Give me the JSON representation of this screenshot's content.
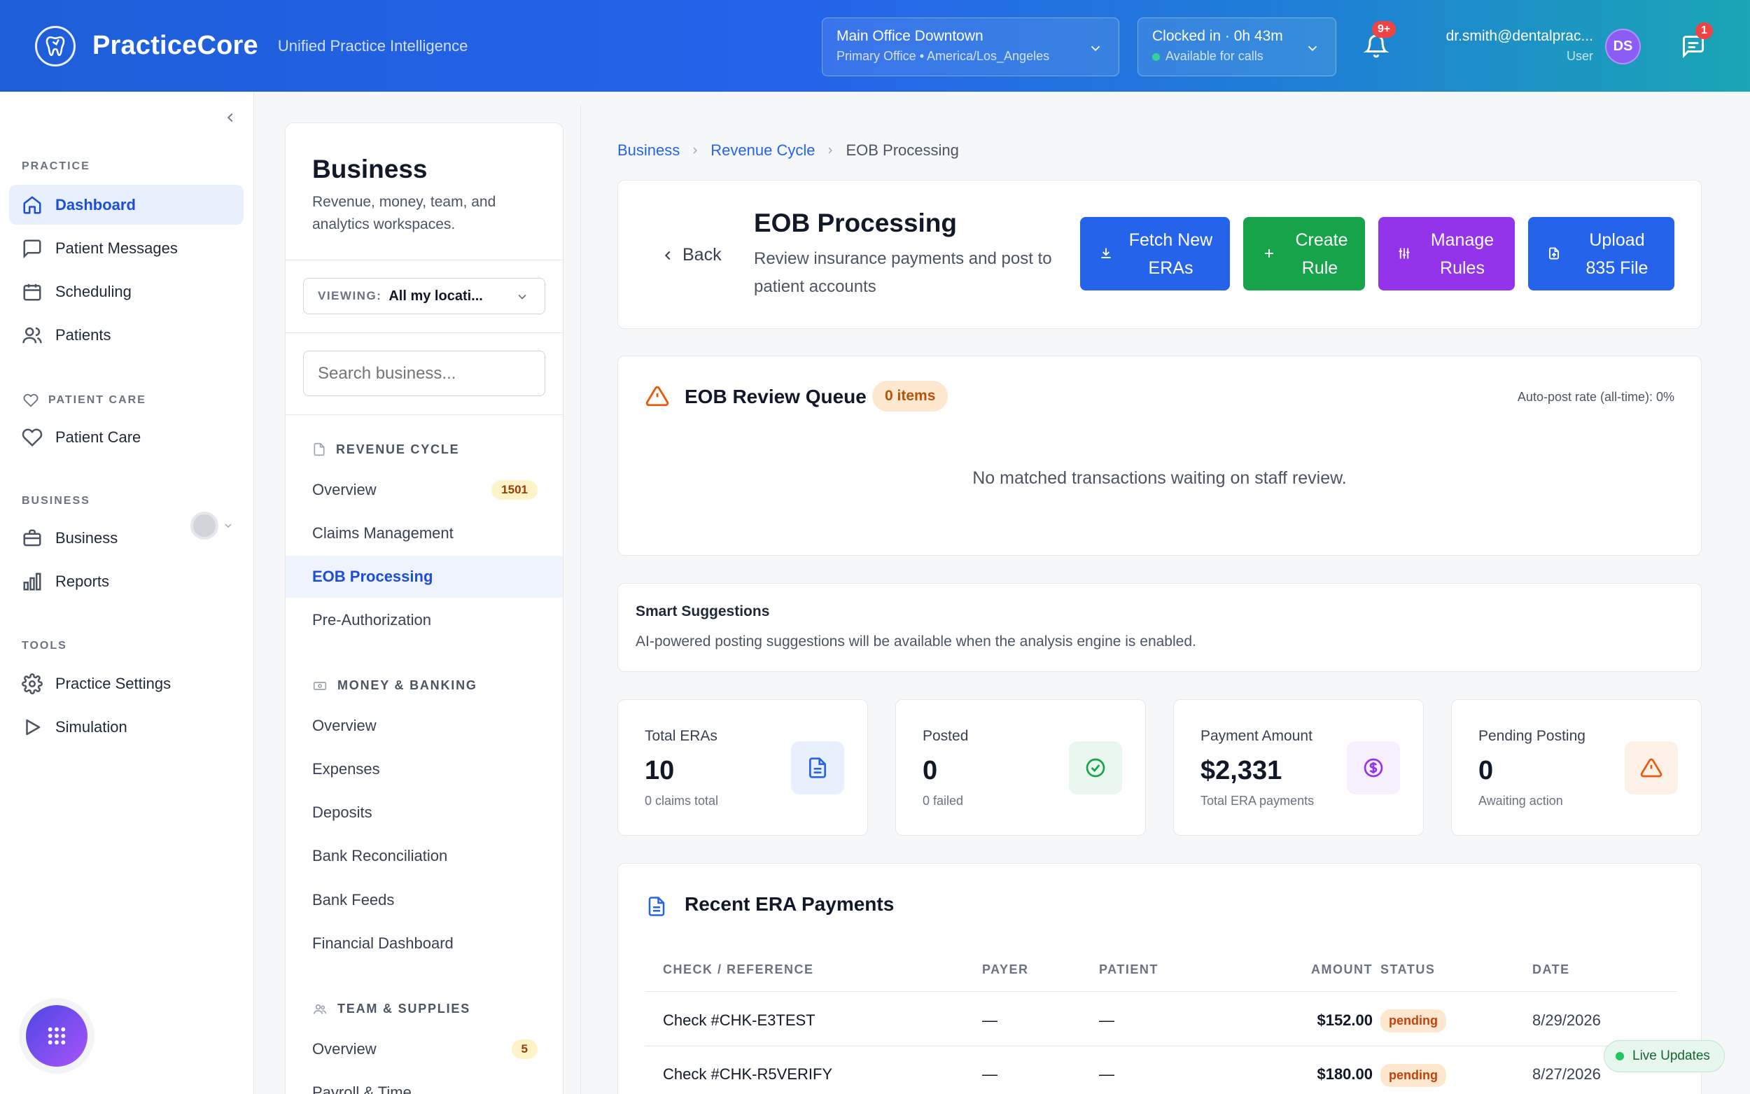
{
  "topbar": {
    "brand": "PracticeCore",
    "tagline": "Unified Practice Intelligence",
    "location": {
      "title": "Main Office Downtown",
      "subtitle": "Primary Office • America/Los_Angeles"
    },
    "clock": {
      "title": "Clocked in · 0h 43m",
      "subtitle": "Available for calls"
    },
    "notifications_badge": "9+",
    "user": {
      "email": "dr.smith@dentalprac...",
      "role": "User",
      "initials": "DS"
    },
    "messages_badge": "1",
    "colors": {
      "start": "#1e5fd8",
      "end": "#1aa6b4"
    }
  },
  "sidebar": {
    "sections": {
      "practice": "PRACTICE",
      "patient_care": "PATIENT CARE",
      "business": "BUSINESS",
      "tools": "TOOLS"
    },
    "items": {
      "dashboard": "Dashboard",
      "patient_messages": "Patient Messages",
      "scheduling": "Scheduling",
      "patients": "Patients",
      "patient_care": "Patient Care",
      "business": "Business",
      "reports": "Reports",
      "practice_settings": "Practice Settings",
      "simulation": "Simulation"
    }
  },
  "business_panel": {
    "title": "Business",
    "description": "Revenue, money, team, and analytics workspaces.",
    "viewing_label": "VIEWING:",
    "viewing_value": "All my locati...",
    "search_placeholder": "Search business...",
    "revenue_cycle": {
      "heading": "REVENUE CYCLE",
      "overview": "Overview",
      "overview_count": "1501",
      "claims": "Claims Management",
      "eob": "EOB Processing",
      "preauth": "Pre-Authorization"
    },
    "money_banking": {
      "heading": "MONEY & BANKING",
      "overview": "Overview",
      "expenses": "Expenses",
      "deposits": "Deposits",
      "reconciliation": "Bank Reconciliation",
      "feeds": "Bank Feeds",
      "dashboard": "Financial Dashboard"
    },
    "team_supplies": {
      "heading": "TEAM & SUPPLIES",
      "overview": "Overview",
      "overview_count": "5",
      "payroll": "Payroll & Time"
    }
  },
  "breadcrumb": {
    "business": "Business",
    "revenue_cycle": "Revenue Cycle",
    "current": "EOB Processing"
  },
  "header": {
    "back": "Back",
    "title": "EOB Processing",
    "description": "Review insurance payments and post to patient accounts",
    "buttons": {
      "fetch": "Fetch New ERAs",
      "create_rule": "Create Rule",
      "manage_rules": "Manage Rules",
      "upload": "Upload 835 File"
    },
    "button_colors": {
      "fetch": "#2563eb",
      "create_rule": "#16a34a",
      "manage_rules": "#9333ea",
      "upload": "#2563eb"
    }
  },
  "queue": {
    "title": "EOB Review Queue",
    "badge": "0 items",
    "autopost": "Auto-post rate (all-time): 0%",
    "empty": "No matched transactions waiting on staff review."
  },
  "suggestions": {
    "title": "Smart Suggestions",
    "text": "AI-powered posting suggestions will be available when the analysis engine is enabled."
  },
  "stats": {
    "total_eras": {
      "label": "Total ERAs",
      "value": "10",
      "sub": "0 claims total"
    },
    "posted": {
      "label": "Posted",
      "value": "0",
      "sub": "0 failed"
    },
    "payment": {
      "label": "Payment Amount",
      "value": "$2,331",
      "sub": "Total ERA payments"
    },
    "pending": {
      "label": "Pending Posting",
      "value": "0",
      "sub": "Awaiting action"
    }
  },
  "recent": {
    "title": "Recent ERA Payments",
    "columns": {
      "check": "CHECK / REFERENCE",
      "payer": "PAYER",
      "patient": "PATIENT",
      "amount": "AMOUNT",
      "status": "STATUS",
      "date": "DATE"
    },
    "rows": [
      {
        "check": "Check #CHK-E3TEST",
        "payer": "—",
        "patient": "—",
        "amount": "$152.00",
        "status": "pending",
        "date": "8/29/2026"
      },
      {
        "check": "Check #CHK-R5VERIFY",
        "payer": "—",
        "patient": "—",
        "amount": "$180.00",
        "status": "pending",
        "date": "8/27/2026"
      }
    ]
  },
  "live_updates": "Live Updates"
}
